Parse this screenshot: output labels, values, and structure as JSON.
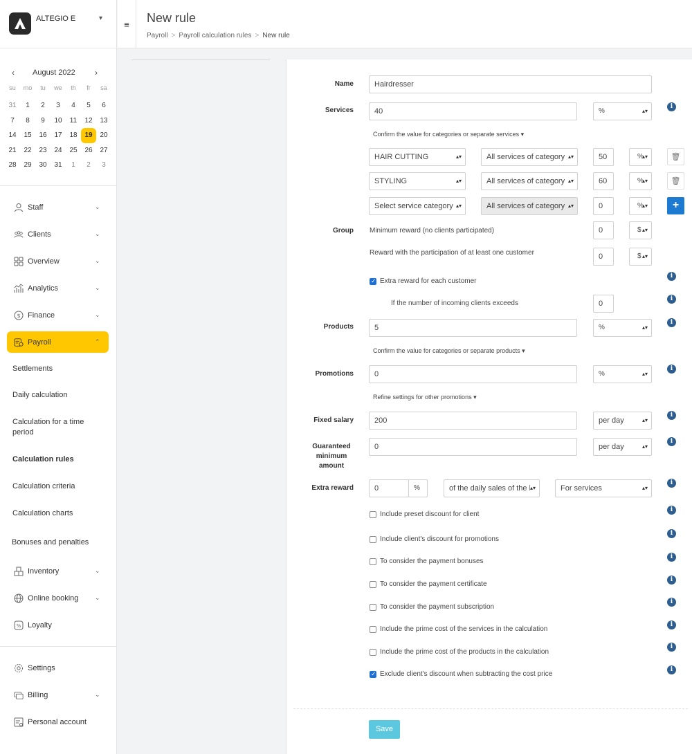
{
  "brand": {
    "name": "ALTEGIO E"
  },
  "calendar": {
    "month": "August 2022",
    "prev": "‹",
    "next": "›",
    "weekdays": [
      "su",
      "mo",
      "tu",
      "we",
      "th",
      "fr",
      "sa"
    ],
    "weeks": [
      [
        "31",
        "1",
        "2",
        "3",
        "4",
        "5",
        "6"
      ],
      [
        "7",
        "8",
        "9",
        "10",
        "11",
        "12",
        "13"
      ],
      [
        "14",
        "15",
        "16",
        "17",
        "18",
        "19",
        "20"
      ],
      [
        "21",
        "22",
        "23",
        "24",
        "25",
        "26",
        "27"
      ],
      [
        "28",
        "29",
        "30",
        "31",
        "1",
        "2",
        "3"
      ]
    ],
    "today": "19"
  },
  "nav": {
    "staff": "Staff",
    "clients": "Clients",
    "overview": "Overview",
    "analytics": "Analytics",
    "finance": "Finance",
    "payroll": "Payroll",
    "sub": {
      "settlements": "Settlements",
      "daily": "Daily calculation",
      "period": "Calculation for a time period",
      "rules": "Calculation rules",
      "criteria": "Calculation criteria",
      "charts": "Calculation charts",
      "bonuses": "Bonuses and penalties"
    },
    "inventory": "Inventory",
    "online_booking": "Online booking",
    "loyalty": "Loyalty",
    "settings": "Settings",
    "billing": "Billing",
    "personal_account": "Personal account"
  },
  "header": {
    "title": "New rule",
    "crumb1": "Payroll",
    "crumb2": "Payroll calculation rules",
    "crumb3": "New rule",
    "sep": ">"
  },
  "form": {
    "name_label": "Name",
    "name_value": "Hairdresser",
    "services_label": "Services",
    "services_value": "40",
    "services_unit": "%",
    "services_confirm": "Confirm the value for categories or separate services ▾",
    "categories": [
      {
        "category": "HAIR CUTTING",
        "scope": "All services of category",
        "value": "50",
        "unit": "%"
      },
      {
        "category": "STYLING",
        "scope": "All services of category",
        "value": "60",
        "unit": "%"
      },
      {
        "category": "Select service category",
        "scope": "All services of category",
        "value": "0",
        "unit": "%"
      }
    ],
    "group_label": "Group",
    "min_reward_text": "Minimum reward (no clients participated)",
    "min_reward_value": "0",
    "min_reward_unit": "$",
    "participation_text": "Reward with the participation of at least one customer",
    "participation_value": "0",
    "participation_unit": "$",
    "extra_each_text": "Extra reward for each customer",
    "exceeds_text": "If the number of incoming clients exceeds",
    "exceeds_value": "0",
    "products_label": "Products",
    "products_value": "5",
    "products_unit": "%",
    "products_confirm": "Confirm the value for categories or separate products ▾",
    "promotions_label": "Promotions",
    "promotions_value": "0",
    "promotions_unit": "%",
    "promotions_refine": "Refine settings for other promotions ▾",
    "fixed_label": "Fixed salary",
    "fixed_value": "200",
    "fixed_unit": "per day",
    "guaranteed_label": "Guaranteed minimum amount",
    "guaranteed_value": "0",
    "guaranteed_unit": "per day",
    "extra_label": "Extra reward",
    "extra_value": "0",
    "extra_pct": "%",
    "extra_base": "of the daily sales of the l",
    "extra_for": "For services",
    "checks": [
      {
        "label": "Include preset discount for client",
        "checked": false
      },
      {
        "label": "Include client's discount for promotions",
        "checked": false
      },
      {
        "label": "To consider the payment bonuses",
        "checked": false
      },
      {
        "label": "To consider the payment certificate",
        "checked": false
      },
      {
        "label": "To consider the payment subscription",
        "checked": false
      },
      {
        "label": "Include the prime cost of the services in the calculation",
        "checked": false
      },
      {
        "label": "Include the prime cost of the products in the calculation",
        "checked": false
      },
      {
        "label": "Exclude client's discount when subtracting the cost price",
        "checked": true
      }
    ],
    "save": "Save"
  },
  "colors": {
    "accent": "#ffc700",
    "info": "#2d5e8f",
    "plus": "#1d7ad1",
    "save": "#5bc8e0"
  }
}
